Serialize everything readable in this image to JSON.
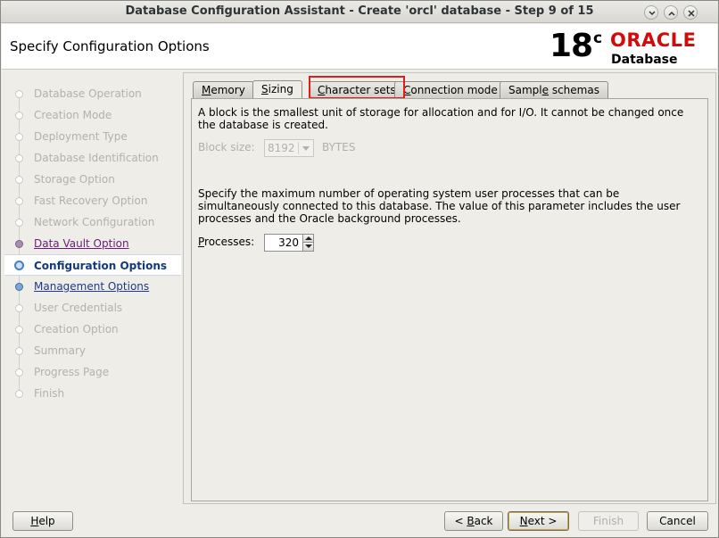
{
  "window": {
    "title": "Database Configuration Assistant - Create 'orcl' database - Step 9 of 15"
  },
  "banner": {
    "heading": "Specify Configuration Options",
    "logo_version": "18",
    "logo_sup": "c",
    "logo_brand": "ORACLE",
    "logo_product": "Database",
    "brand_color": "#d30a0a"
  },
  "steps": [
    {
      "label": "Database Operation",
      "state": "disabled"
    },
    {
      "label": "Creation Mode",
      "state": "disabled"
    },
    {
      "label": "Deployment Type",
      "state": "disabled"
    },
    {
      "label": "Database Identification",
      "state": "disabled"
    },
    {
      "label": "Storage Option",
      "state": "disabled"
    },
    {
      "label": "Fast Recovery Option",
      "state": "disabled"
    },
    {
      "label": "Network Configuration",
      "state": "disabled"
    },
    {
      "label": "Data Vault Option",
      "state": "visited"
    },
    {
      "label": "Configuration Options",
      "state": "current"
    },
    {
      "label": "Management Options",
      "state": "link"
    },
    {
      "label": "User Credentials",
      "state": "disabled"
    },
    {
      "label": "Creation Option",
      "state": "disabled"
    },
    {
      "label": "Summary",
      "state": "disabled"
    },
    {
      "label": "Progress Page",
      "state": "disabled"
    },
    {
      "label": "Finish",
      "state": "disabled"
    }
  ],
  "tabs": [
    {
      "label_pre": "",
      "label_u": "M",
      "label_post": "emory",
      "active": false
    },
    {
      "label_pre": "",
      "label_u": "S",
      "label_post": "izing",
      "active": true
    },
    {
      "label_pre": "",
      "label_u": "C",
      "label_post": "haracter sets",
      "active": false,
      "highlighted": true
    },
    {
      "label_pre": "",
      "label_u": "C",
      "label_post": "onnection mode",
      "active": false
    },
    {
      "label_pre": "Sampl",
      "label_u": "e",
      "label_post": " schemas",
      "active": false
    }
  ],
  "sizing": {
    "block_text": "A block is the smallest unit of storage for allocation and for I/O. It cannot be changed once the database is created.",
    "block_size_label": "Block size:",
    "block_size_value": "8192",
    "block_size_unit": "BYTES",
    "processes_text": "Specify the maximum number of operating system user processes that can be simultaneously connected to this database. The value of this parameter includes the user processes and the Oracle background processes.",
    "processes_label": "Processes:",
    "processes_value": "320"
  },
  "buttons": {
    "help": "Help",
    "back": "< Back",
    "next": "Next >",
    "finish": "Finish",
    "cancel": "Cancel"
  },
  "highlight_color": "#e01e1e"
}
